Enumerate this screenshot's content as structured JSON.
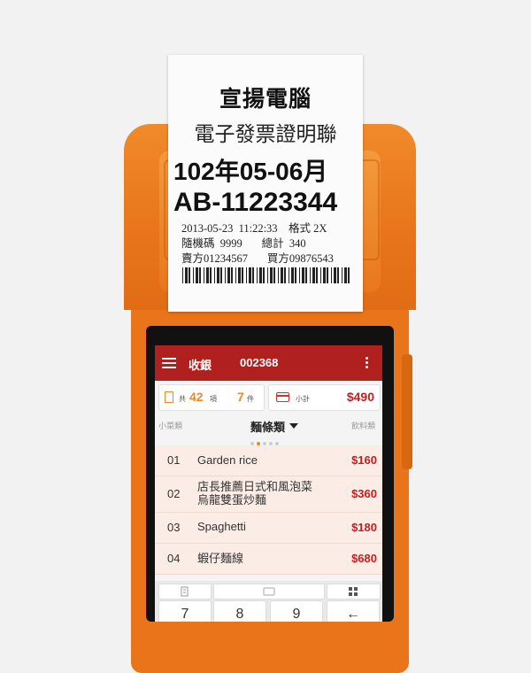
{
  "receipt": {
    "company": "宣揚電腦",
    "doc_type": "電子發票證明聯",
    "period": "102年05-06月",
    "invoice_number": "AB-11223344",
    "line1": "2013-05-23  11:22:33    格式 2X",
    "line2": "隨機碼  9999       總計  340",
    "line3": "賣方01234567       買方09876543"
  },
  "app": {
    "title": "收銀",
    "order_number": "002368",
    "summary": {
      "items_label": "共",
      "items_count": "42",
      "items_unit": "項",
      "qty_count": "7",
      "qty_unit": "件",
      "subtotal_label": "小計",
      "total": "$490"
    },
    "categories": {
      "prev": "小菜類",
      "current": "麵條類",
      "next": "飲料類"
    },
    "items": [
      {
        "no": "01",
        "name": "Garden rice",
        "price": "$160"
      },
      {
        "no": "02",
        "name": "店長推薦日式和風泡菜\n烏龍雙蛋炒麵",
        "price": "$360"
      },
      {
        "no": "03",
        "name": "Spaghetti",
        "price": "$180"
      },
      {
        "no": "04",
        "name": "蝦仔麵線",
        "price": "$680"
      }
    ],
    "keypad": [
      "7",
      "8",
      "9",
      "←"
    ]
  },
  "colors": {
    "device_orange": "#e97419",
    "app_bar_red": "#b0201f",
    "price_red": "#c0201f",
    "accent_orange": "#e8892a"
  }
}
